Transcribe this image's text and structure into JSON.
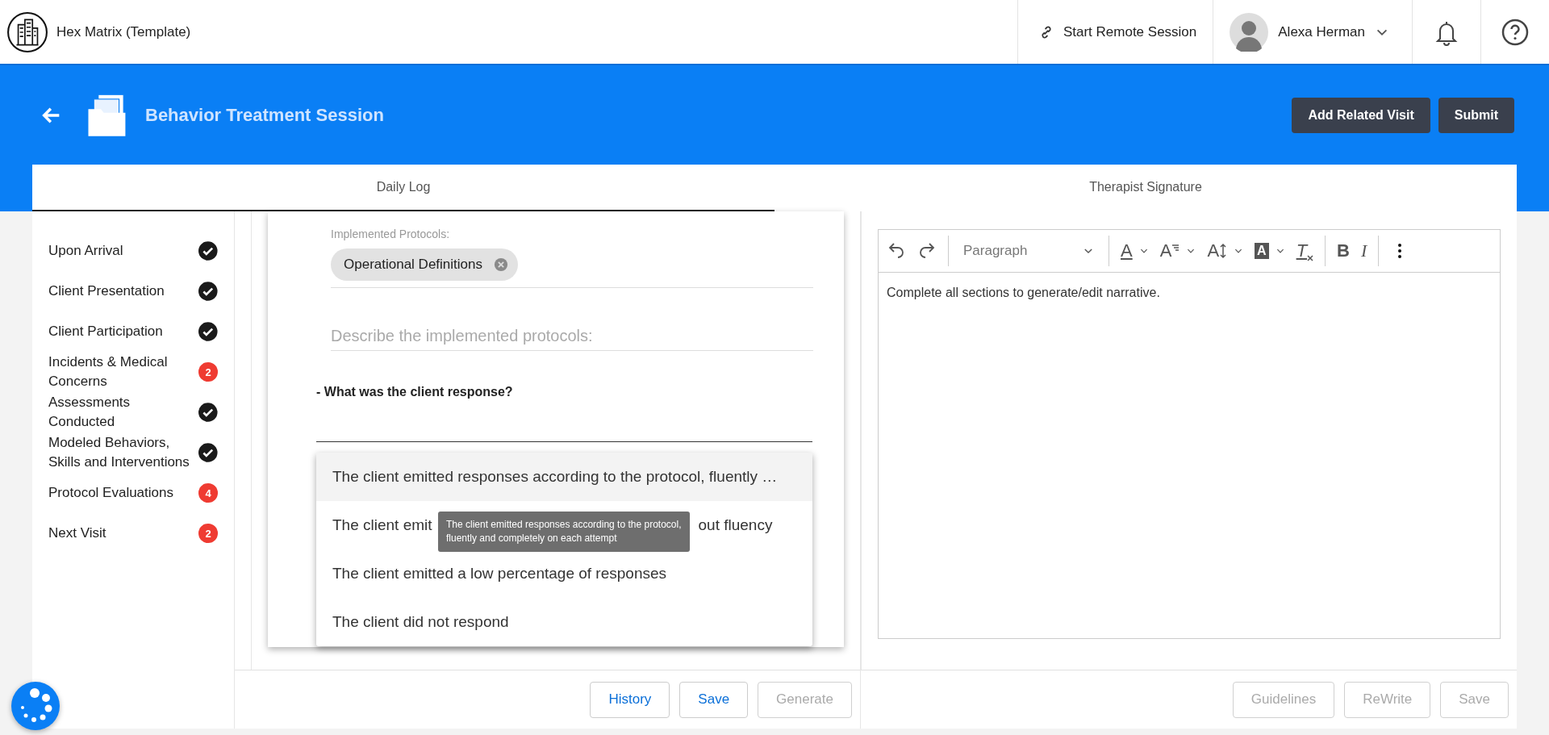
{
  "app": {
    "title": "Hex Matrix (Template)"
  },
  "header": {
    "remote_session": "Start Remote Session",
    "user": "Alexa Herman"
  },
  "page": {
    "title": "Behavior Treatment Session",
    "buttons": [
      "Add Related Visit",
      "Submit"
    ]
  },
  "tabs": [
    {
      "label": "Daily Log",
      "selected": true
    },
    {
      "label": "Therapist Signature",
      "selected": false
    }
  ],
  "sidebar": {
    "items": [
      {
        "label": "Upon Arrival",
        "kind": "done"
      },
      {
        "label": "Client Presentation",
        "kind": "done"
      },
      {
        "label": "Client Participation",
        "kind": "done"
      },
      {
        "label": "Incidents & Medical Concerns",
        "kind": "count",
        "count": "2"
      },
      {
        "label": "Assessments Conducted",
        "kind": "done"
      },
      {
        "label": "Modeled Behaviors, Skills and Interventions",
        "kind": "done"
      },
      {
        "label": "Protocol Evaluations",
        "kind": "count",
        "count": "4"
      },
      {
        "label": "Next Visit",
        "kind": "count",
        "count": "2"
      }
    ]
  },
  "form": {
    "protocols_label": "Implemented Protocols:",
    "chips": [
      "Operational Definitions"
    ],
    "describe": {
      "placeholder": "Describe the implemented protocols:"
    },
    "question": "- What was the client response?",
    "options": [
      {
        "parts": [
          "The client emitted responses according to the protocol, fluently …"
        ],
        "selected": true
      },
      {
        "parts": [
          "The client emit",
          "out fluency"
        ],
        "selected": false
      },
      {
        "parts": [
          "The client emitted a low percentage of responses"
        ],
        "selected": false
      },
      {
        "parts": [
          "The client did not respond"
        ],
        "selected": false
      }
    ],
    "tooltip": "The client emitted responses according to the protocol, fluently and completely on each attempt",
    "buttons": [
      {
        "label": "History",
        "disabled": false
      },
      {
        "label": "Save",
        "disabled": false
      },
      {
        "label": "Generate",
        "disabled": true
      }
    ]
  },
  "editor": {
    "toolbar": [
      {
        "kind": "undo"
      },
      {
        "kind": "redo"
      },
      {
        "kind": "divider"
      },
      {
        "kind": "select",
        "label": "Paragraph"
      },
      {
        "kind": "divider"
      },
      {
        "kind": "font-color",
        "glyph": "A"
      },
      {
        "kind": "font-family",
        "glyph": "A"
      },
      {
        "kind": "font-size",
        "glyph": "A"
      },
      {
        "kind": "highlight",
        "glyph": "A"
      },
      {
        "kind": "clear",
        "glyph": "T"
      },
      {
        "kind": "divider"
      },
      {
        "kind": "bold",
        "glyph": "B"
      },
      {
        "kind": "italic",
        "glyph": "I"
      },
      {
        "kind": "divider"
      },
      {
        "kind": "more"
      }
    ],
    "text": "Complete all sections to generate/edit narrative.",
    "buttons": [
      {
        "label": "Guidelines",
        "disabled": true
      },
      {
        "label": "ReWrite",
        "disabled": true
      },
      {
        "label": "Save",
        "disabled": true
      }
    ]
  }
}
